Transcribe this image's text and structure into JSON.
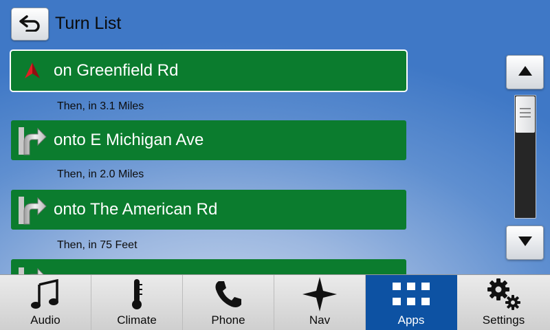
{
  "header": {
    "back_icon": "back-arrow-icon",
    "title": "Turn List"
  },
  "turn_list": {
    "items": [
      {
        "icon": "navigation-arrow-icon",
        "instruction": "on Greenfield Rd",
        "selected": true,
        "then": "Then, in 3.1 Miles"
      },
      {
        "icon": "turn-right-icon",
        "instruction": "onto E Michigan Ave",
        "selected": false,
        "then": "Then, in 2.0 Miles"
      },
      {
        "icon": "turn-right-icon",
        "instruction": "onto The American Rd",
        "selected": false,
        "then": "Then, in 75 Feet"
      },
      {
        "icon": "turn-right-icon",
        "instruction": "",
        "selected": false,
        "then": ""
      }
    ]
  },
  "scrollbar": {
    "up_icon": "triangle-up-icon",
    "down_icon": "triangle-down-icon",
    "thumb_fraction": 0.3,
    "position_fraction": 0.0
  },
  "bottom_bar": {
    "items": [
      {
        "label": "Audio",
        "icon": "music-note-icon",
        "active": false
      },
      {
        "label": "Climate",
        "icon": "thermometer-icon",
        "active": false
      },
      {
        "label": "Phone",
        "icon": "phone-icon",
        "active": false
      },
      {
        "label": "Nav",
        "icon": "compass-star-icon",
        "active": false
      },
      {
        "label": "Apps",
        "icon": "apps-grid-icon",
        "active": true
      },
      {
        "label": "Settings",
        "icon": "gears-icon",
        "active": false
      }
    ]
  },
  "colors": {
    "row_green": "#0b7c2e",
    "active_tab_blue": "#0d52a3",
    "nav_arrow_red": "#d3191c"
  }
}
